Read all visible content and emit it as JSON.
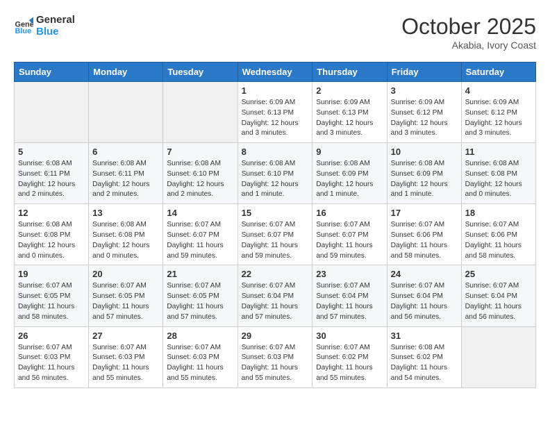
{
  "header": {
    "logo_line1": "General",
    "logo_line2": "Blue",
    "month": "October 2025",
    "location": "Akabia, Ivory Coast"
  },
  "weekdays": [
    "Sunday",
    "Monday",
    "Tuesday",
    "Wednesday",
    "Thursday",
    "Friday",
    "Saturday"
  ],
  "weeks": [
    [
      {
        "day": "",
        "info": ""
      },
      {
        "day": "",
        "info": ""
      },
      {
        "day": "",
        "info": ""
      },
      {
        "day": "1",
        "info": "Sunrise: 6:09 AM\nSunset: 6:13 PM\nDaylight: 12 hours\nand 3 minutes."
      },
      {
        "day": "2",
        "info": "Sunrise: 6:09 AM\nSunset: 6:13 PM\nDaylight: 12 hours\nand 3 minutes."
      },
      {
        "day": "3",
        "info": "Sunrise: 6:09 AM\nSunset: 6:12 PM\nDaylight: 12 hours\nand 3 minutes."
      },
      {
        "day": "4",
        "info": "Sunrise: 6:09 AM\nSunset: 6:12 PM\nDaylight: 12 hours\nand 3 minutes."
      }
    ],
    [
      {
        "day": "5",
        "info": "Sunrise: 6:08 AM\nSunset: 6:11 PM\nDaylight: 12 hours\nand 2 minutes."
      },
      {
        "day": "6",
        "info": "Sunrise: 6:08 AM\nSunset: 6:11 PM\nDaylight: 12 hours\nand 2 minutes."
      },
      {
        "day": "7",
        "info": "Sunrise: 6:08 AM\nSunset: 6:10 PM\nDaylight: 12 hours\nand 2 minutes."
      },
      {
        "day": "8",
        "info": "Sunrise: 6:08 AM\nSunset: 6:10 PM\nDaylight: 12 hours\nand 1 minute."
      },
      {
        "day": "9",
        "info": "Sunrise: 6:08 AM\nSunset: 6:09 PM\nDaylight: 12 hours\nand 1 minute."
      },
      {
        "day": "10",
        "info": "Sunrise: 6:08 AM\nSunset: 6:09 PM\nDaylight: 12 hours\nand 1 minute."
      },
      {
        "day": "11",
        "info": "Sunrise: 6:08 AM\nSunset: 6:08 PM\nDaylight: 12 hours\nand 0 minutes."
      }
    ],
    [
      {
        "day": "12",
        "info": "Sunrise: 6:08 AM\nSunset: 6:08 PM\nDaylight: 12 hours\nand 0 minutes."
      },
      {
        "day": "13",
        "info": "Sunrise: 6:08 AM\nSunset: 6:08 PM\nDaylight: 12 hours\nand 0 minutes."
      },
      {
        "day": "14",
        "info": "Sunrise: 6:07 AM\nSunset: 6:07 PM\nDaylight: 11 hours\nand 59 minutes."
      },
      {
        "day": "15",
        "info": "Sunrise: 6:07 AM\nSunset: 6:07 PM\nDaylight: 11 hours\nand 59 minutes."
      },
      {
        "day": "16",
        "info": "Sunrise: 6:07 AM\nSunset: 6:07 PM\nDaylight: 11 hours\nand 59 minutes."
      },
      {
        "day": "17",
        "info": "Sunrise: 6:07 AM\nSunset: 6:06 PM\nDaylight: 11 hours\nand 58 minutes."
      },
      {
        "day": "18",
        "info": "Sunrise: 6:07 AM\nSunset: 6:06 PM\nDaylight: 11 hours\nand 58 minutes."
      }
    ],
    [
      {
        "day": "19",
        "info": "Sunrise: 6:07 AM\nSunset: 6:05 PM\nDaylight: 11 hours\nand 58 minutes."
      },
      {
        "day": "20",
        "info": "Sunrise: 6:07 AM\nSunset: 6:05 PM\nDaylight: 11 hours\nand 57 minutes."
      },
      {
        "day": "21",
        "info": "Sunrise: 6:07 AM\nSunset: 6:05 PM\nDaylight: 11 hours\nand 57 minutes."
      },
      {
        "day": "22",
        "info": "Sunrise: 6:07 AM\nSunset: 6:04 PM\nDaylight: 11 hours\nand 57 minutes."
      },
      {
        "day": "23",
        "info": "Sunrise: 6:07 AM\nSunset: 6:04 PM\nDaylight: 11 hours\nand 57 minutes."
      },
      {
        "day": "24",
        "info": "Sunrise: 6:07 AM\nSunset: 6:04 PM\nDaylight: 11 hours\nand 56 minutes."
      },
      {
        "day": "25",
        "info": "Sunrise: 6:07 AM\nSunset: 6:04 PM\nDaylight: 11 hours\nand 56 minutes."
      }
    ],
    [
      {
        "day": "26",
        "info": "Sunrise: 6:07 AM\nSunset: 6:03 PM\nDaylight: 11 hours\nand 56 minutes."
      },
      {
        "day": "27",
        "info": "Sunrise: 6:07 AM\nSunset: 6:03 PM\nDaylight: 11 hours\nand 55 minutes."
      },
      {
        "day": "28",
        "info": "Sunrise: 6:07 AM\nSunset: 6:03 PM\nDaylight: 11 hours\nand 55 minutes."
      },
      {
        "day": "29",
        "info": "Sunrise: 6:07 AM\nSunset: 6:03 PM\nDaylight: 11 hours\nand 55 minutes."
      },
      {
        "day": "30",
        "info": "Sunrise: 6:07 AM\nSunset: 6:02 PM\nDaylight: 11 hours\nand 55 minutes."
      },
      {
        "day": "31",
        "info": "Sunrise: 6:08 AM\nSunset: 6:02 PM\nDaylight: 11 hours\nand 54 minutes."
      },
      {
        "day": "",
        "info": ""
      }
    ]
  ]
}
